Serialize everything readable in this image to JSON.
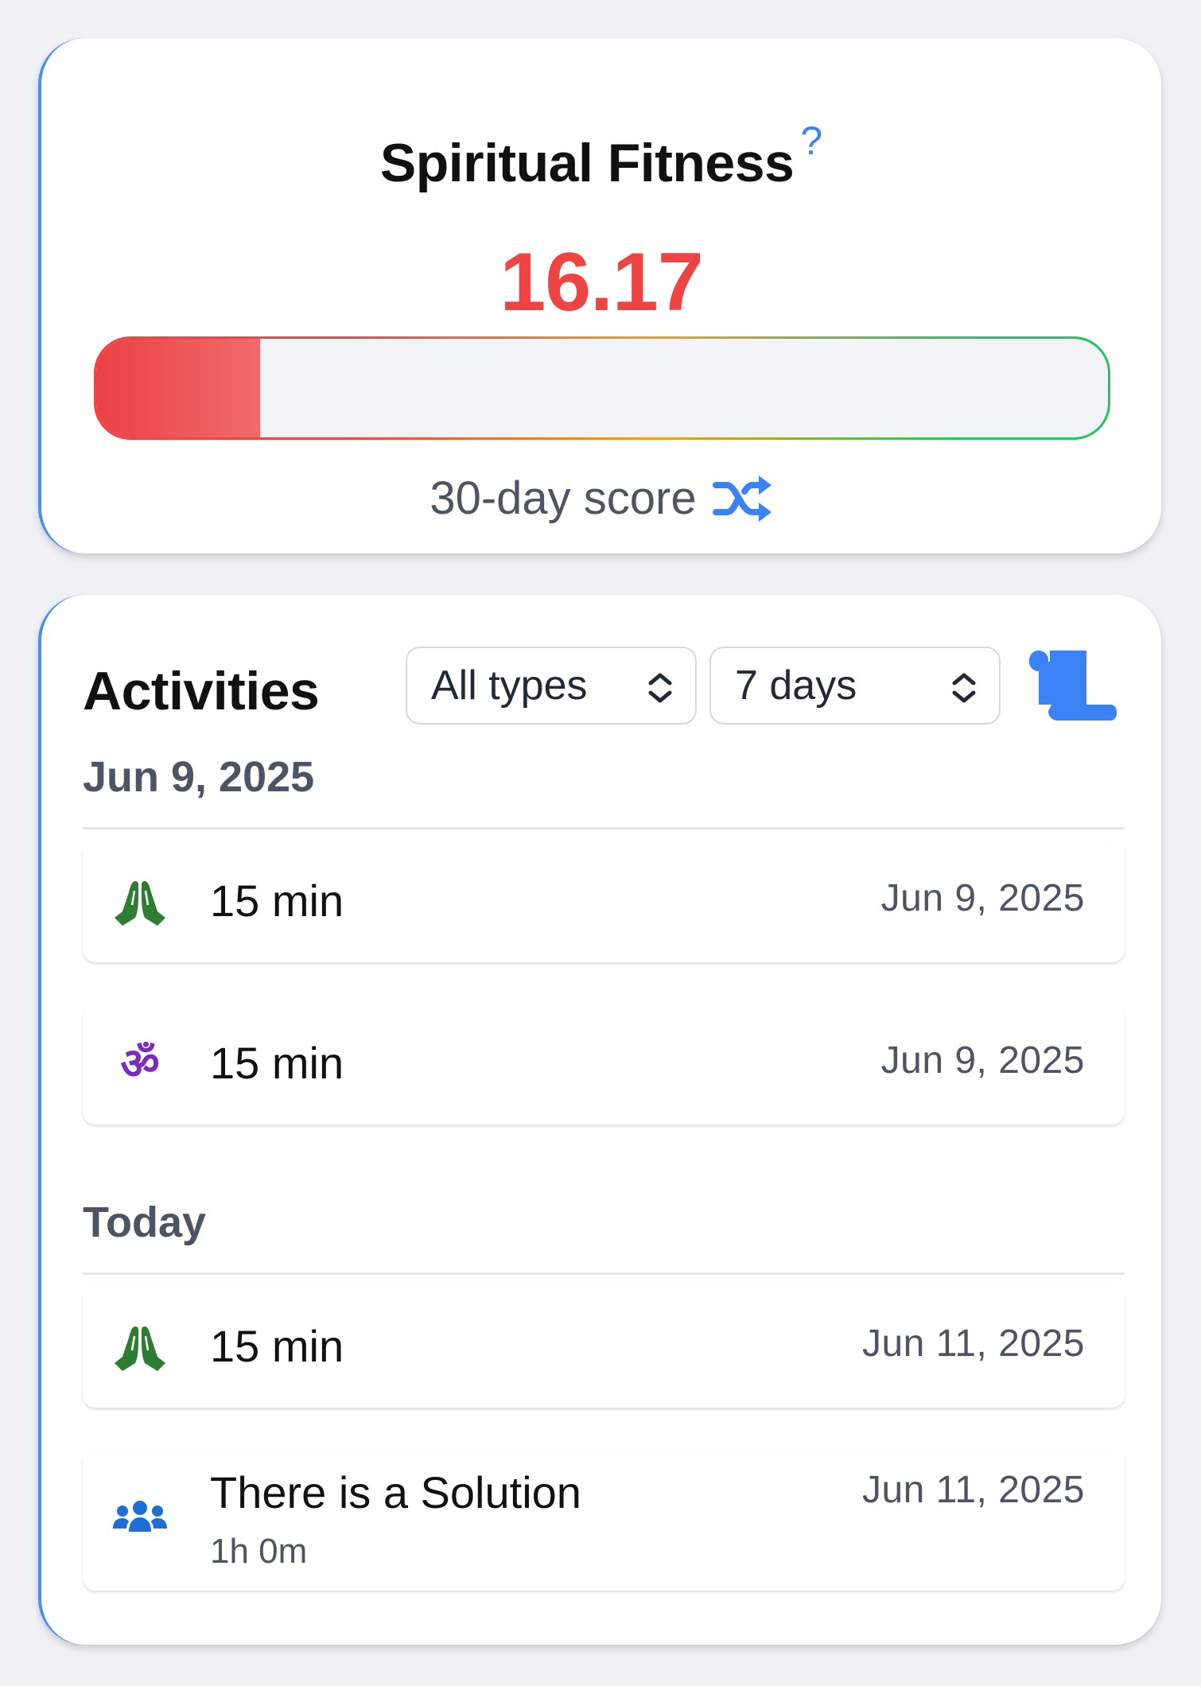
{
  "fitness": {
    "title": "Spiritual Fitness",
    "help_symbol": "?",
    "score": "16.17",
    "score_fraction": 0.1617,
    "score_label": "30-day score",
    "colors": {
      "score": "#ef4444",
      "accent": "#3b82f6",
      "bar_low": "#ef4444",
      "bar_high": "#22c55e"
    }
  },
  "activities": {
    "title": "Activities",
    "type_filter": {
      "selected": "All types"
    },
    "range_filter": {
      "selected": "7 days"
    },
    "groups": [
      {
        "header": "Jun 9, 2025",
        "items": [
          {
            "icon": "praying-hands-icon",
            "title": "15 min",
            "subtitle": "",
            "date": "Jun 9, 2025"
          },
          {
            "icon": "om-icon",
            "title": "15 min",
            "subtitle": "",
            "date": "Jun 9, 2025"
          }
        ]
      },
      {
        "header": "Today",
        "items": [
          {
            "icon": "praying-hands-icon",
            "title": "15 min",
            "subtitle": "",
            "date": "Jun 11, 2025"
          },
          {
            "icon": "users-icon",
            "title": "There is a Solution",
            "subtitle": "1h 0m",
            "date": "Jun 11, 2025"
          }
        ]
      }
    ]
  },
  "icons": {
    "om_glyph": "ॐ",
    "shuffle": "shuffle-icon",
    "scroll": "scroll-icon"
  }
}
